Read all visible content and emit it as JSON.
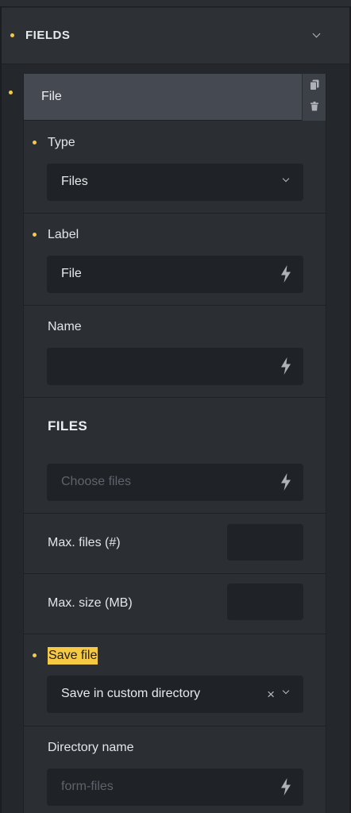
{
  "header": {
    "title": "FIELDS",
    "toggle_icon": "chevron-down-icon"
  },
  "field_card": {
    "title": "File",
    "actions": [
      {
        "icon": "copy-icon"
      },
      {
        "icon": "trash-icon"
      }
    ]
  },
  "type": {
    "label": "Type",
    "value": "Files"
  },
  "label_field": {
    "label": "Label",
    "value": "File"
  },
  "name_field": {
    "label": "Name",
    "value": ""
  },
  "files_group": {
    "title": "FILES",
    "placeholder": "Choose files"
  },
  "max_files": {
    "label": "Max. files (#)",
    "value": ""
  },
  "max_size": {
    "label": "Max. size (MB)",
    "value": ""
  },
  "save_file": {
    "label": "Save file",
    "value": "Save in custom directory",
    "clear_glyph": "×"
  },
  "directory_name": {
    "label": "Directory name",
    "placeholder": "form-files"
  },
  "colors": {
    "accent": "#f6c945",
    "panel": "#2b2e33",
    "input": "#1f2226",
    "header": "#454a52"
  }
}
